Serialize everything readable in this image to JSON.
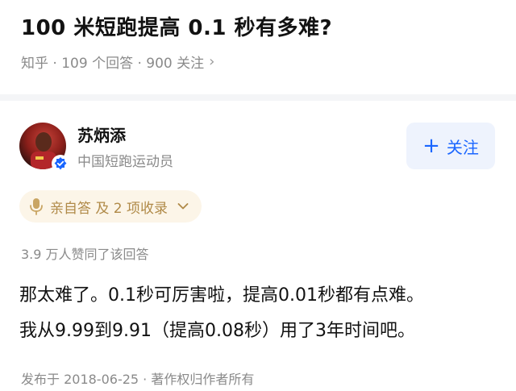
{
  "question": {
    "title": "100 米短跑提高 0.1 秒有多难?",
    "meta": "知乎 · 109 个回答 · 900 关注"
  },
  "author": {
    "name": "苏炳添",
    "headline": "中国短跑运动员"
  },
  "follow_button": {
    "label": "关注"
  },
  "answer_badge": {
    "label": "亲自答 及 2 项收录"
  },
  "answer": {
    "upvotes": "3.9 万人赞同了该回答",
    "paragraphs": [
      "那太难了。0.1秒可厉害啦，提高0.01秒都有点难。",
      "我从9.99到9.91（提高0.08秒）用了3年时间吧。"
    ],
    "publish_info": "发布于 2018-06-25 · 著作权归作者所有"
  },
  "colors": {
    "accent": "#1a66ff",
    "follow_bg": "#eef3fd",
    "badge_bg": "#fcf5e8",
    "badge_text": "#b08a48",
    "muted": "#8a8a8a"
  },
  "icons": {
    "meta_chevron": "chevron-right-icon",
    "verified": "verified-check-icon",
    "follow": "plus-icon",
    "badge": "microphone-icon",
    "badge_chevron": "chevron-down-icon"
  }
}
